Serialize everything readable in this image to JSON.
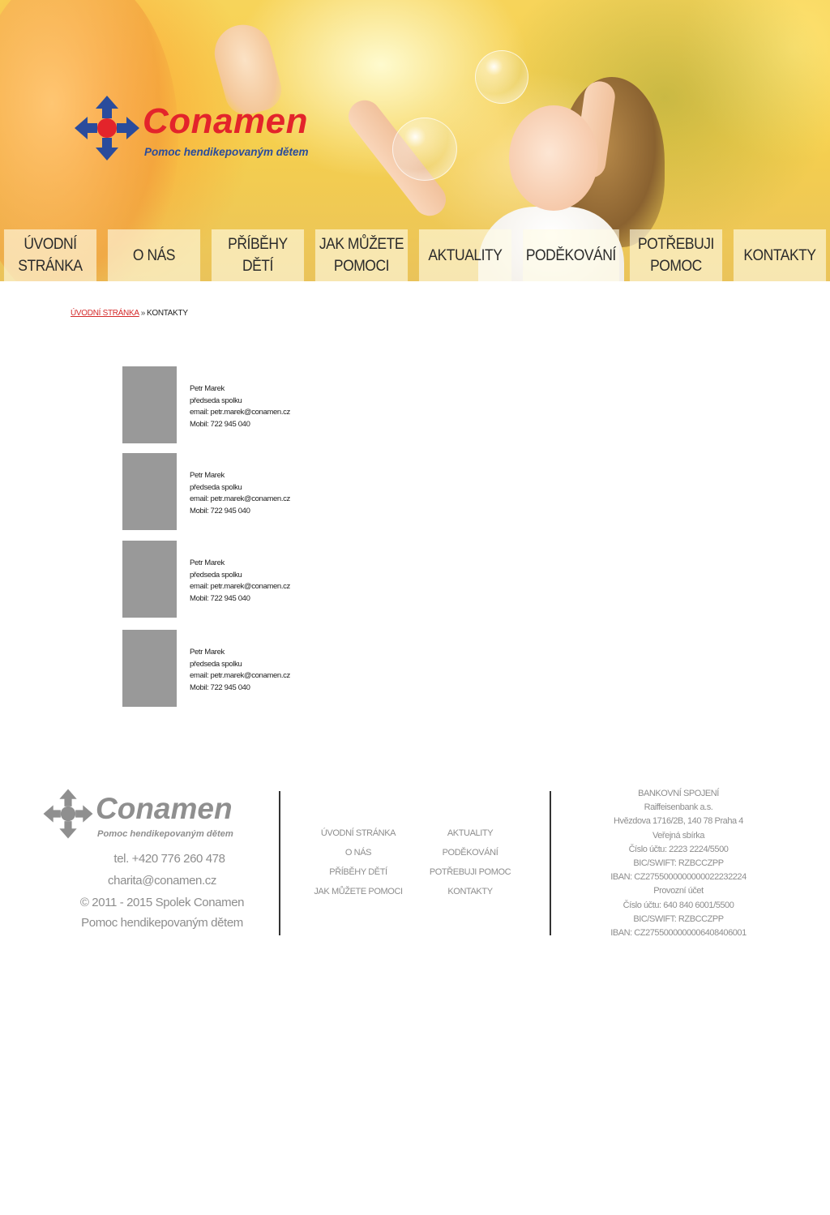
{
  "brand": {
    "name": "Conamen",
    "tagline": "Pomoc hendikepovaným dětem",
    "logo_colors": {
      "text": "#e3242b",
      "tagline": "#2a4c9c",
      "arrows": "#2a4c9c",
      "center": "#e3242b"
    }
  },
  "nav": {
    "items": [
      {
        "label": "ÚVODNÍ\nSTRÁNKA"
      },
      {
        "label": "O NÁS"
      },
      {
        "label": "PŘÍBĚHY\nDĚTÍ"
      },
      {
        "label": "JAK MŮŽETE\nPOMOCI"
      },
      {
        "label": "AKTUALITY"
      },
      {
        "label": "PODĚKOVÁNÍ"
      },
      {
        "label": "POTŘEBUJI\nPOMOC"
      },
      {
        "label": "KONTAKTY"
      }
    ]
  },
  "breadcrumb": {
    "home": "ÚVODNÍ STRÁNKA",
    "separator": "»",
    "current": "KONTAKTY"
  },
  "contacts": [
    {
      "name": "Petr Marek",
      "role": "předseda spolku",
      "email": "email: petr.marek@conamen.cz",
      "phone": "Mobil: 722 945 040"
    },
    {
      "name": "Petr Marek",
      "role": "předseda spolku",
      "email": "email: petr.marek@conamen.cz",
      "phone": "Mobil: 722 945 040"
    },
    {
      "name": "Petr Marek",
      "role": "předseda spolku",
      "email": "email: petr.marek@conamen.cz",
      "phone": "Mobil: 722 945 040"
    },
    {
      "name": "Petr Marek",
      "role": "předseda spolku",
      "email": "email: petr.marek@conamen.cz",
      "phone": "Mobil: 722 945 040"
    }
  ],
  "footer": {
    "logo_text": "Conamen",
    "logo_sub": "Pomoc hendikepovaným dětem",
    "tel": "tel. +420 776 260 478",
    "email": "charita@conamen.cz",
    "copyright": "© 2011 - 2015 Spolek Conamen",
    "copyright_sub": "Pomoc hendikepovaným dětem",
    "menu_col1": [
      "ÚVODNÍ STRÁNKA",
      "O NÁS",
      "PŘÍBĚHY DĚTÍ",
      "JAK MŮŽETE POMOCI"
    ],
    "menu_col2": [
      "AKTUALITY",
      "PODĚKOVÁNÍ",
      "POTŘEBUJI POMOC",
      "KONTAKTY"
    ],
    "bank": [
      "BANKOVNÍ SPOJENÍ",
      "Raiffeisenbank a.s.",
      "Hvězdova 1716/2B, 140 78 Praha 4",
      "Veřejná sbírka",
      "Číslo účtu: 2223 2224/5500",
      "BIC/SWIFT: RZBCCZPP",
      "IBAN: CZ2755000000000022232224",
      "Provozní účet",
      "Číslo účtu: 640 840 6001/5500",
      "BIC/SWIFT: RZBCCZPP",
      "IBAN: CZ2755000000006408406001"
    ]
  }
}
